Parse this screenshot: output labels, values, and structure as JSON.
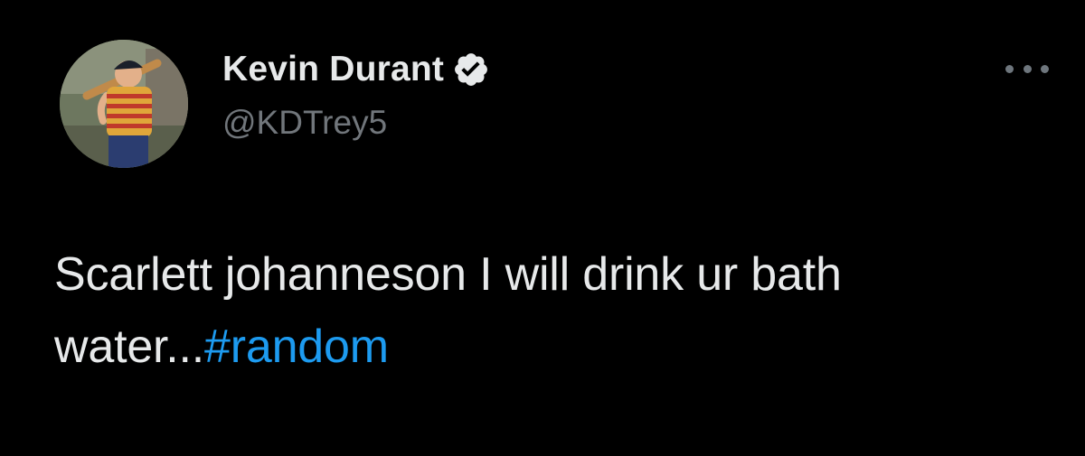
{
  "tweet": {
    "author": {
      "display_name": "Kevin Durant",
      "handle": "@KDTrey5",
      "verified": true,
      "avatar_icon": "avatar-photo"
    },
    "more_icon": "more-dots-icon",
    "text_line1": "Scarlett johanneson I will drink ur bath",
    "text_line2_prefix": "water...",
    "hashtag": "#random"
  },
  "colors": {
    "background": "#000000",
    "text": "#e7e9ea",
    "secondary": "#71767b",
    "link": "#1d9bf0"
  }
}
